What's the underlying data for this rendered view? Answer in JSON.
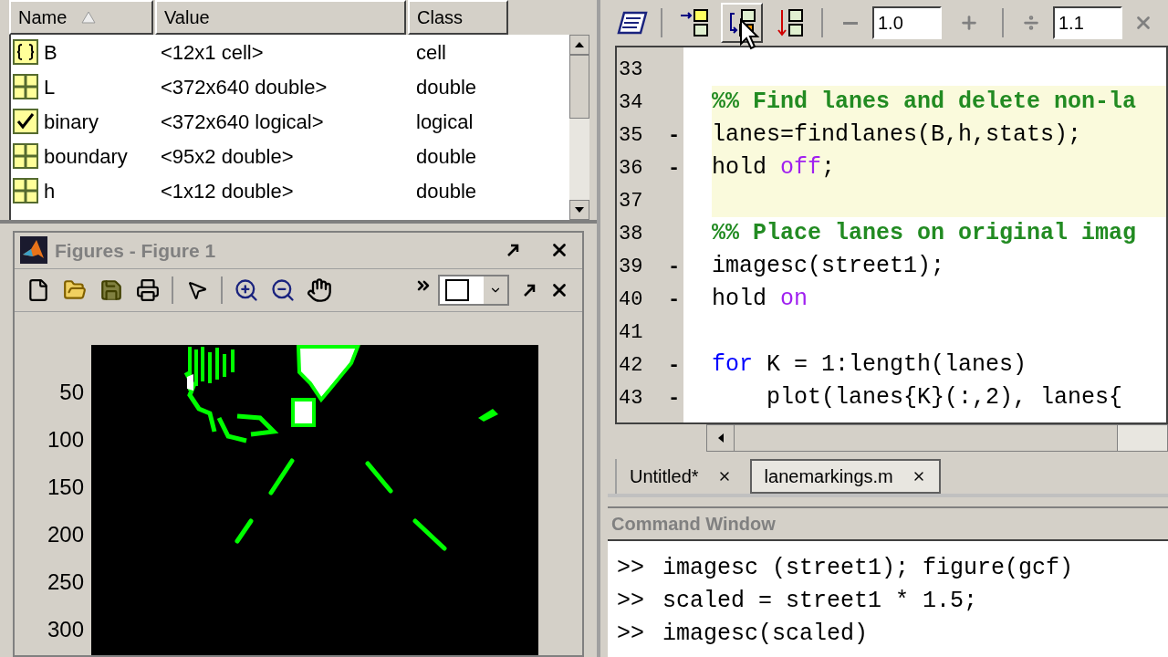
{
  "workspace": {
    "columns": [
      {
        "label": "Name",
        "sorted": true
      },
      {
        "label": "Value",
        "sorted": false
      },
      {
        "label": "Class",
        "sorted": false
      }
    ],
    "rows": [
      {
        "kind": "cell",
        "name": "B",
        "value": "<12x1 cell>",
        "class": "cell"
      },
      {
        "kind": "matrix",
        "name": "L",
        "value": "<372x640 double>",
        "class": "double"
      },
      {
        "kind": "logical",
        "name": "binary",
        "value": "<372x640 logical>",
        "class": "logical"
      },
      {
        "kind": "matrix",
        "name": "boundary",
        "value": "<95x2 double>",
        "class": "double"
      },
      {
        "kind": "matrix",
        "name": "h",
        "value": "<1x12 double>",
        "class": "double"
      }
    ]
  },
  "figure": {
    "title": "Figures - Figure 1",
    "yticks": [
      "50",
      "100",
      "150",
      "200",
      "250",
      "300"
    ]
  },
  "editor": {
    "cell_buttons": [
      {
        "kind": "insert",
        "pressed": false
      },
      {
        "kind": "nest",
        "pressed": true
      },
      {
        "kind": "step",
        "pressed": false
      }
    ],
    "fields": [
      {
        "value": "1.0"
      },
      {
        "value": "1.1"
      }
    ],
    "lines": [
      {
        "number": "33",
        "cell": false
      },
      {
        "number": "34",
        "cell": true,
        "tokens": [
          {
            "kind": "comment",
            "text": "%% Find lanes and delete non-la"
          }
        ]
      },
      {
        "number": "35",
        "marker": "-",
        "cell": true,
        "tokens": [
          {
            "kind": "plain",
            "text": "lanes=findlanes(B,h,stats);"
          }
        ]
      },
      {
        "number": "36",
        "marker": "-",
        "cell": true,
        "tokens": [
          {
            "kind": "plain",
            "text": "hold "
          },
          {
            "kind": "string",
            "text": "off"
          },
          {
            "kind": "plain",
            "text": ";"
          }
        ]
      },
      {
        "number": "37",
        "cell": true
      },
      {
        "number": "38",
        "cell": false,
        "tokens": [
          {
            "kind": "comment",
            "text": "%% Place lanes on original imag"
          }
        ]
      },
      {
        "number": "39",
        "marker": "-",
        "cell": false,
        "tokens": [
          {
            "kind": "plain",
            "text": "imagesc(street1);"
          }
        ]
      },
      {
        "number": "40",
        "marker": "-",
        "cell": false,
        "tokens": [
          {
            "kind": "plain",
            "text": "hold "
          },
          {
            "kind": "string",
            "text": "on"
          }
        ]
      },
      {
        "number": "41",
        "cell": false
      },
      {
        "number": "42",
        "marker": "-",
        "cell": false,
        "tokens": [
          {
            "kind": "keyword",
            "text": "for"
          },
          {
            "kind": "plain",
            "text": " K = 1:length(lanes)"
          }
        ]
      },
      {
        "number": "43",
        "marker": "-",
        "cell": false,
        "tokens": [
          {
            "kind": "plain",
            "text": "    plot(lanes{K}(:,2), lanes{"
          }
        ]
      }
    ],
    "tabs": [
      {
        "label": "Untitled*",
        "selected": false
      },
      {
        "label": "lanemarkings.m",
        "selected": true
      }
    ]
  },
  "command_window": {
    "title": "Command Window",
    "lines": [
      {
        "prompt": ">>",
        "text": "imagesc (street1); figure(gcf)"
      },
      {
        "prompt": ">>",
        "text": "scaled = street1 * 1.5;"
      },
      {
        "prompt": ">>",
        "text": "imagesc(scaled)"
      }
    ]
  }
}
